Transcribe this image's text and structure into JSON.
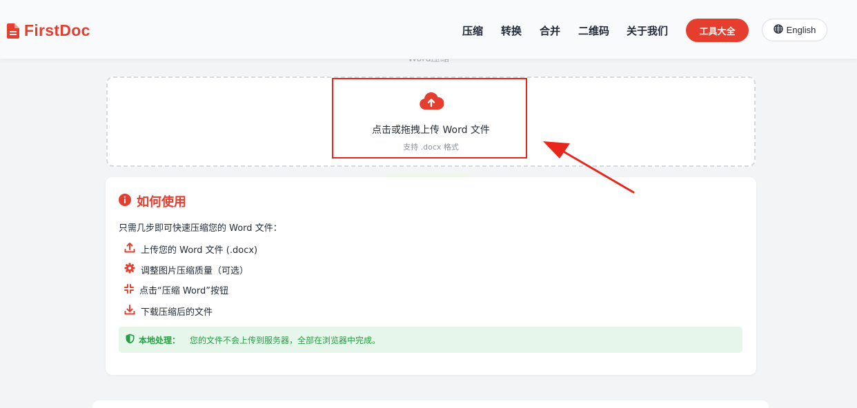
{
  "brand": {
    "name": "FirstDoc",
    "color": "#e53e2f",
    "logo_icon": "file-icon"
  },
  "nav": {
    "items": [
      {
        "label": "压缩"
      },
      {
        "label": "转换"
      },
      {
        "label": "合并"
      },
      {
        "label": "二维码"
      },
      {
        "label": "关于我们"
      }
    ],
    "tools_button": "工具大全",
    "language": {
      "label": "English",
      "icon": "globe-icon"
    }
  },
  "page": {
    "subtitle": "Word压缩"
  },
  "upload": {
    "icon": "cloud-upload-icon",
    "prompt": "点击或拖拽上传 Word 文件",
    "hint": "支持 .docx 格式"
  },
  "how_to": {
    "icon": "info-circle-icon",
    "title": "如何使用",
    "intro": "只需几步即可快速压缩您的 Word 文件：",
    "steps": [
      {
        "icon": "upload-icon",
        "text": "上传您的 Word 文件 (.docx)"
      },
      {
        "icon": "gear-icon",
        "text": "调整图片压缩质量（可选）"
      },
      {
        "icon": "compress-icon",
        "text": "点击“压缩 Word”按钮"
      },
      {
        "icon": "download-icon",
        "text": "下载压缩后的文件"
      }
    ],
    "notice": {
      "icon": "shield-icon",
      "label": "本地处理：",
      "message": "您的文件不会上传到服务器，全部在浏览器中完成。"
    }
  },
  "colors": {
    "accent": "#e53e2f",
    "success": "#22a043",
    "annotation": "#e8261c"
  }
}
